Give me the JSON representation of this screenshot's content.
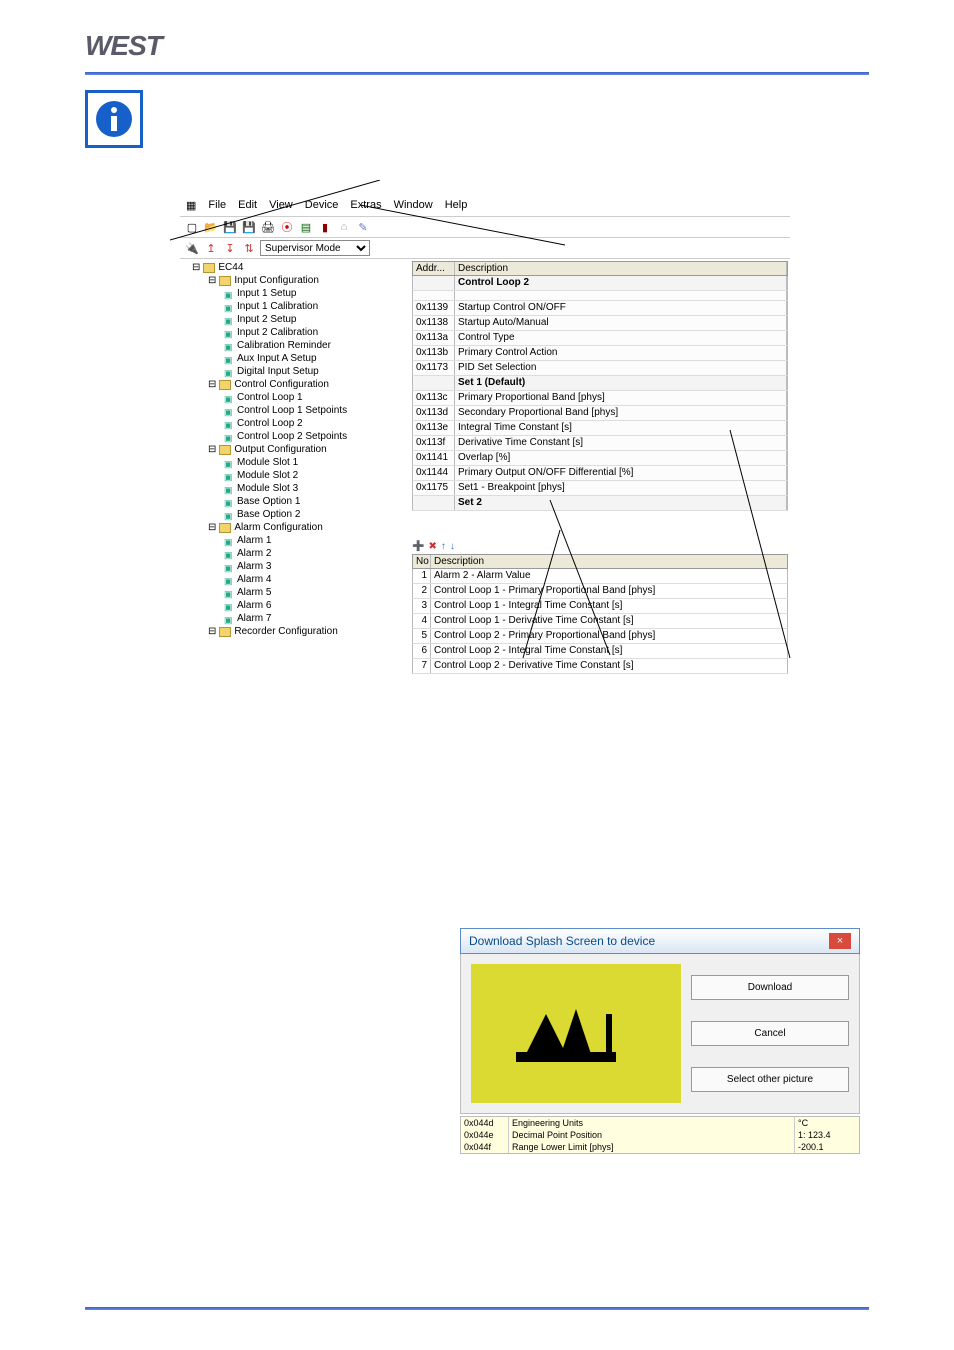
{
  "brand": "WEST",
  "menubar": [
    "File",
    "Edit",
    "View",
    "Device",
    "Extras",
    "Window",
    "Help"
  ],
  "mode_select": "Supervisor Mode",
  "tree": [
    {
      "lvl": 1,
      "type": "root",
      "label": "EC44"
    },
    {
      "lvl": 2,
      "type": "folder",
      "label": "Input Configuration"
    },
    {
      "lvl": 3,
      "type": "leaf",
      "label": "Input 1 Setup"
    },
    {
      "lvl": 3,
      "type": "leaf",
      "label": "Input 1 Calibration"
    },
    {
      "lvl": 3,
      "type": "leaf",
      "label": "Input 2 Setup"
    },
    {
      "lvl": 3,
      "type": "leaf",
      "label": "Input 2 Calibration"
    },
    {
      "lvl": 3,
      "type": "leaf",
      "label": "Calibration Reminder"
    },
    {
      "lvl": 3,
      "type": "leaf",
      "label": "Aux Input A Setup"
    },
    {
      "lvl": 3,
      "type": "leaf",
      "label": "Digital Input Setup"
    },
    {
      "lvl": 2,
      "type": "folder",
      "label": "Control Configuration"
    },
    {
      "lvl": 3,
      "type": "leaf",
      "label": "Control Loop 1"
    },
    {
      "lvl": 3,
      "type": "leaf",
      "label": "Control Loop 1 Setpoints"
    },
    {
      "lvl": 3,
      "type": "leaf",
      "label": "Control Loop 2"
    },
    {
      "lvl": 3,
      "type": "leaf",
      "label": "Control Loop 2 Setpoints"
    },
    {
      "lvl": 2,
      "type": "folder",
      "label": "Output Configuration"
    },
    {
      "lvl": 3,
      "type": "leaf",
      "label": "Module Slot 1"
    },
    {
      "lvl": 3,
      "type": "leaf",
      "label": "Module Slot 2"
    },
    {
      "lvl": 3,
      "type": "leaf",
      "label": "Module Slot 3"
    },
    {
      "lvl": 3,
      "type": "leaf",
      "label": "Base Option 1"
    },
    {
      "lvl": 3,
      "type": "leaf",
      "label": "Base Option 2"
    },
    {
      "lvl": 2,
      "type": "folder",
      "label": "Alarm Configuration"
    },
    {
      "lvl": 3,
      "type": "leaf",
      "label": "Alarm 1"
    },
    {
      "lvl": 3,
      "type": "leaf",
      "label": "Alarm 2"
    },
    {
      "lvl": 3,
      "type": "leaf",
      "label": "Alarm 3"
    },
    {
      "lvl": 3,
      "type": "leaf",
      "label": "Alarm 4"
    },
    {
      "lvl": 3,
      "type": "leaf",
      "label": "Alarm 5"
    },
    {
      "lvl": 3,
      "type": "leaf",
      "label": "Alarm 6"
    },
    {
      "lvl": 3,
      "type": "leaf",
      "label": "Alarm 7"
    },
    {
      "lvl": 2,
      "type": "folder",
      "label": "Recorder Configuration"
    }
  ],
  "grid_header": {
    "addr": "Addr...",
    "desc": "Description"
  },
  "grid_title": "Control Loop 2",
  "grid_rows": [
    {
      "addr": "0x1139",
      "desc": "Startup Control ON/OFF"
    },
    {
      "addr": "0x1138",
      "desc": "Startup Auto/Manual"
    },
    {
      "addr": "0x113a",
      "desc": "Control Type"
    },
    {
      "addr": "0x113b",
      "desc": "Primary Control Action"
    },
    {
      "addr": "0x1173",
      "desc": "PID Set Selection"
    }
  ],
  "set1_header": "Set 1 (Default)",
  "set1_rows": [
    {
      "addr": "0x113c",
      "desc": "Primary Proportional Band [phys]"
    },
    {
      "addr": "0x113d",
      "desc": "Secondary Proportional Band [phys]"
    },
    {
      "addr": "0x113e",
      "desc": "Integral Time Constant [s]"
    },
    {
      "addr": "0x113f",
      "desc": "Derivative Time Constant [s]"
    },
    {
      "addr": "0x1141",
      "desc": "Overlap [%]"
    },
    {
      "addr": "0x1144",
      "desc": "Primary Output ON/OFF Differential [%]"
    },
    {
      "addr": "0x1175",
      "desc": "Set1 - Breakpoint [phys]"
    }
  ],
  "set2_header": "Set 2",
  "sec_grid_header": {
    "no": "No",
    "desc": "Description"
  },
  "sec_rows": [
    {
      "no": "1",
      "desc": "Alarm 2 - Alarm Value"
    },
    {
      "no": "2",
      "desc": "Control Loop 1 - Primary Proportional Band [phys]"
    },
    {
      "no": "3",
      "desc": "Control Loop 1 - Integral Time Constant [s]"
    },
    {
      "no": "4",
      "desc": "Control Loop 1 - Derivative Time Constant [s]"
    },
    {
      "no": "5",
      "desc": "Control Loop 2 - Primary Proportional Band [phys]"
    },
    {
      "no": "6",
      "desc": "Control Loop 2 - Integral Time Constant [s]"
    },
    {
      "no": "7",
      "desc": "Control Loop 2 - Derivative Time Constant [s]"
    }
  ],
  "dialog": {
    "title": "Download Splash Screen to device",
    "btn_download": "Download",
    "btn_cancel": "Cancel",
    "btn_select": "Select other picture",
    "footer": [
      {
        "addr": "0x044d",
        "desc": "Engineering Units",
        "val": "°C"
      },
      {
        "addr": "0x044e",
        "desc": "Decimal Point Position",
        "val": "1: 123.4"
      },
      {
        "addr": "0x044f",
        "desc": "Range Lower Limit [phys]",
        "val": "-200.1"
      }
    ]
  }
}
